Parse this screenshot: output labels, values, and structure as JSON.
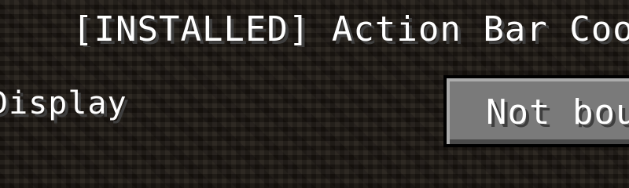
{
  "mod_entry": {
    "title": "[INSTALLED] Action Bar Coor"
  },
  "keybind_option": {
    "label": "Display",
    "button_label": "Not bou"
  },
  "colors": {
    "background": "#1e1913",
    "text": "#ffffff",
    "text_shadow": "#3f3f3f",
    "button_face": "#7a7a7a",
    "button_border": "#000000"
  }
}
